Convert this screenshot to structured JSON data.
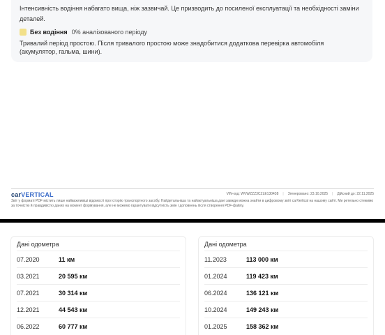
{
  "driving_intensity": {
    "description": "Інтенсивність водіння набагато вища, ніж зазвичай. Це призводить до посиленої експлуатації та необхідності заміни деталей."
  },
  "no_driving": {
    "label": "Без водіння",
    "percent": "0% аналізованого періоду",
    "tag_color": "#f2e08a",
    "description": "Тривалий період простою. Після тривалого простою може знадобитися додаткова перевірка автомобіля (акумулятор, гальма, шини)."
  },
  "footer": {
    "brand_part1": "car",
    "brand_part2": "VERTICAL",
    "vin": "VIN-код: WVWZZZ3CZLE130438",
    "generated": "Згенеровано: 23.10.2025",
    "valid": "Дійсний до: 22.11.2025",
    "note": "Звіт у форматі PDF містить лише найважливіші відомості про історію транспортного засобу. Найдетальніша та найактуальніша дані завжди можна знайти в цифровому звіті carVertical на нашому сайті. Ми ретельно стежимо за точністю й правдивістю даних на момент формування, але не можемо гарантувати відсутність змін і доповнень після створення PDF-файлу."
  },
  "odometer_left": {
    "title": "Дані одометра",
    "rows": [
      {
        "date": "07.2020",
        "km": "11 км"
      },
      {
        "date": "03.2021",
        "km": "20 595 км"
      },
      {
        "date": "07.2021",
        "km": "30 314 км"
      },
      {
        "date": "12.2021",
        "km": "44 543 км"
      },
      {
        "date": "06.2022",
        "km": "60 777 км"
      }
    ]
  },
  "odometer_right": {
    "title": "Дані одометра",
    "rows": [
      {
        "date": "11.2023",
        "km": "113 000 км"
      },
      {
        "date": "01.2024",
        "km": "119 423 км"
      },
      {
        "date": "06.2024",
        "km": "136 121 км"
      },
      {
        "date": "10.2024",
        "km": "149 243 км"
      },
      {
        "date": "01.2025",
        "km": "158 362 км"
      }
    ]
  }
}
